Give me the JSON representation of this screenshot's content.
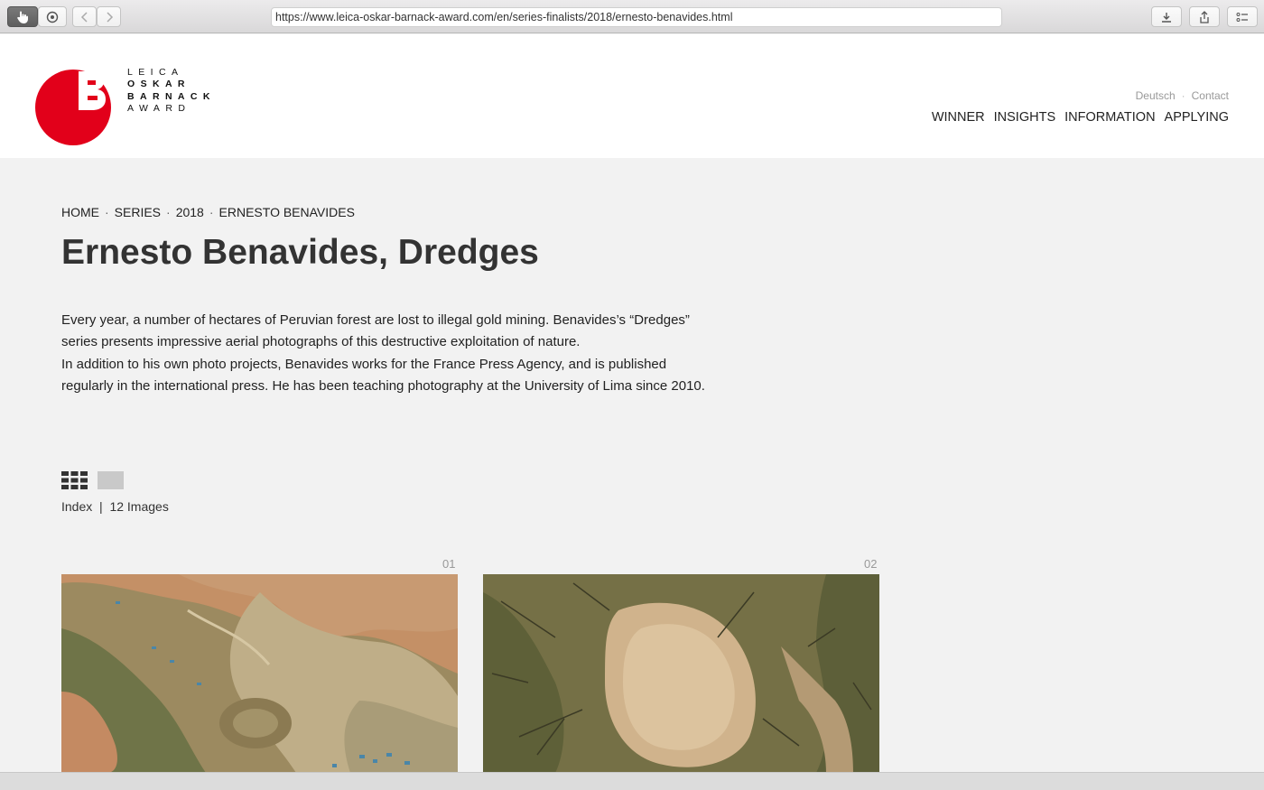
{
  "browser": {
    "url": "https://www.leica-oskar-barnack-award.com/en/series-finalists/2018/ernesto-benavides.html"
  },
  "logo": {
    "line1": "LEICA",
    "line2": "OSKAR",
    "line3": "BARNACK",
    "line4": "AWARD",
    "brand_color": "#e2001a"
  },
  "header": {
    "lang_deutsch": "Deutsch",
    "lang_sep": "·",
    "contact": "Contact",
    "nav": [
      "WINNER",
      "INSIGHTS",
      "INFORMATION",
      "APPLYING"
    ]
  },
  "breadcrumb": {
    "items": [
      "HOME",
      "SERIES",
      "2018",
      "ERNESTO BENAVIDES"
    ],
    "sep": "·"
  },
  "page": {
    "title": "Ernesto Benavides, Dredges",
    "description_p1": "Every year, a number of hectares of Peruvian forest are lost to illegal gold mining. Benavides’s “Dredges” series presents impressive aerial photographs of this destructive exploitation of nature.",
    "description_p2": "In addition to his own photo projects, Benavides works for the France Press Agency, and is published regularly in the international press. He has been teaching photography at the University of Lima since 2010."
  },
  "view": {
    "index_label": "Index",
    "separator": "|",
    "count_label": "12 Images"
  },
  "gallery": [
    {
      "number": "01"
    },
    {
      "number": "02"
    }
  ]
}
